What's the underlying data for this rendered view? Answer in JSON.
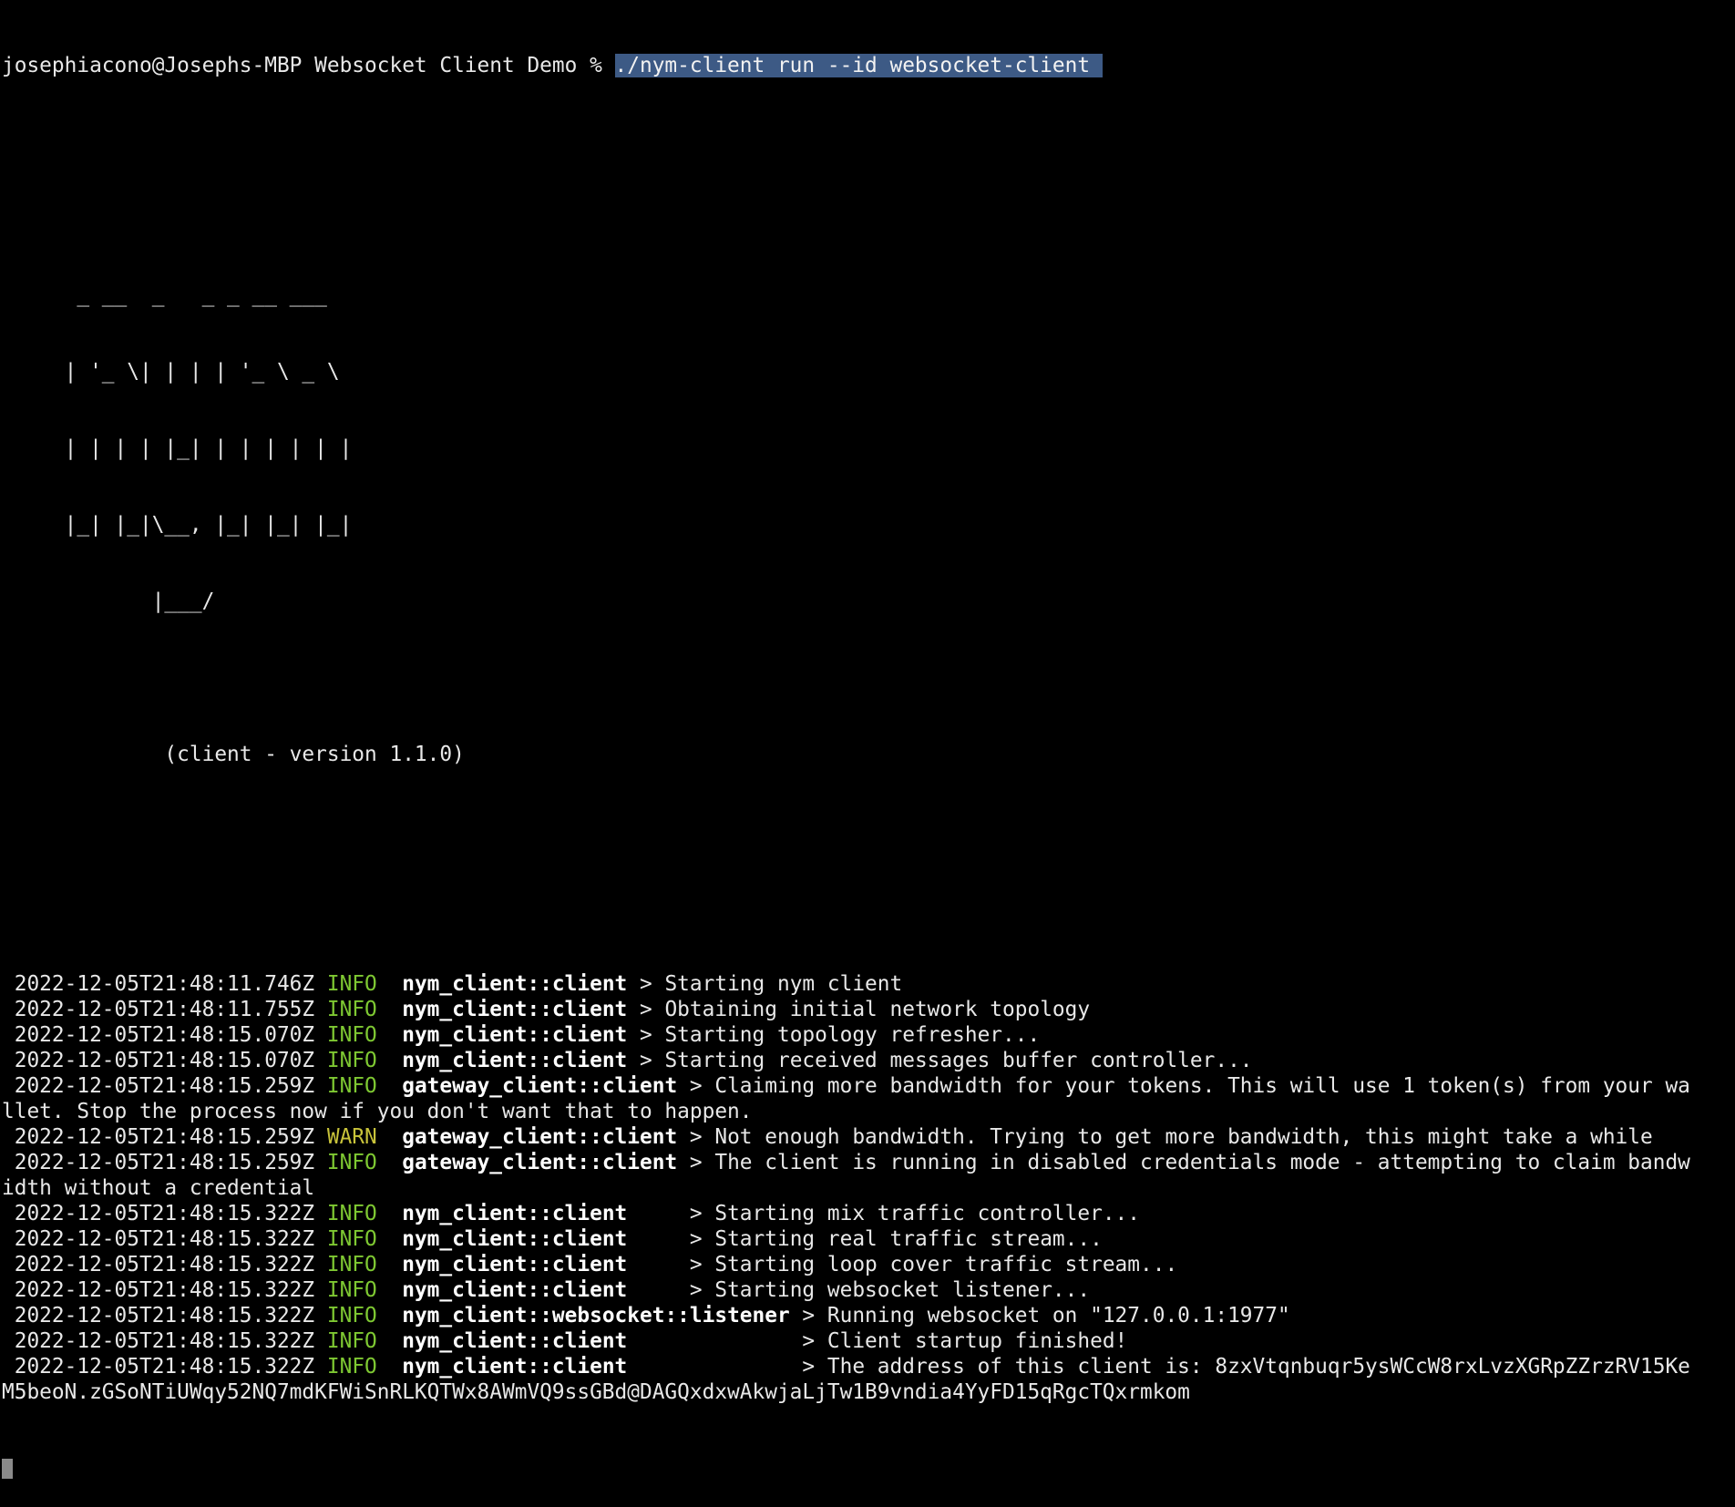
{
  "terminal": {
    "prompt": "josephiacono@Josephs-MBP Websocket Client Demo % ",
    "command": "./nym-client run --id websocket-client "
  },
  "banner": {
    "ascii": [
      "      _ __  _   _ _ __ ___",
      "     | '_ \\| | | | '_ \\ _ \\",
      "     | | | | |_| | | | | | |",
      "     |_| |_|\\__, |_| |_| |_|",
      "            |___/"
    ],
    "version": "             (client - version 1.1.0)"
  },
  "logs": [
    {
      "ts": " 2022-12-05T21:48:11.746Z",
      "level": "INFO",
      "target": "nym_client::client",
      "msg": " > Starting nym client"
    },
    {
      "ts": " 2022-12-05T21:48:11.755Z",
      "level": "INFO",
      "target": "nym_client::client",
      "msg": " > Obtaining initial network topology"
    },
    {
      "ts": " 2022-12-05T21:48:15.070Z",
      "level": "INFO",
      "target": "nym_client::client",
      "msg": " > Starting topology refresher..."
    },
    {
      "ts": " 2022-12-05T21:48:15.070Z",
      "level": "INFO",
      "target": "nym_client::client",
      "msg": " > Starting received messages buffer controller..."
    },
    {
      "ts": " 2022-12-05T21:48:15.259Z",
      "level": "INFO",
      "target": "gateway_client::client",
      "msg": " > Claiming more bandwidth for your tokens. This will use 1 token(s) from your wa",
      "cont": "llet. Stop the process now if you don't want that to happen."
    },
    {
      "ts": " 2022-12-05T21:48:15.259Z",
      "level": "WARN",
      "target": "gateway_client::client",
      "msg": " > Not enough bandwidth. Trying to get more bandwidth, this might take a while"
    },
    {
      "ts": " 2022-12-05T21:48:15.259Z",
      "level": "INFO",
      "target": "gateway_client::client",
      "msg": " > The client is running in disabled credentials mode - attempting to claim bandw",
      "cont": "idth without a credential"
    },
    {
      "ts": " 2022-12-05T21:48:15.322Z",
      "level": "INFO",
      "target": "nym_client::client",
      "msg": "     > Starting mix traffic controller..."
    },
    {
      "ts": " 2022-12-05T21:48:15.322Z",
      "level": "INFO",
      "target": "nym_client::client",
      "msg": "     > Starting real traffic stream..."
    },
    {
      "ts": " 2022-12-05T21:48:15.322Z",
      "level": "INFO",
      "target": "nym_client::client",
      "msg": "     > Starting loop cover traffic stream..."
    },
    {
      "ts": " 2022-12-05T21:48:15.322Z",
      "level": "INFO",
      "target": "nym_client::client",
      "msg": "     > Starting websocket listener..."
    },
    {
      "ts": " 2022-12-05T21:48:15.322Z",
      "level": "INFO",
      "target": "nym_client::websocket::listener",
      "msg": " > Running websocket on \"127.0.0.1:1977\""
    },
    {
      "ts": " 2022-12-05T21:48:15.322Z",
      "level": "INFO",
      "target": "nym_client::client",
      "msg": "              > Client startup finished!"
    },
    {
      "ts": " 2022-12-05T21:48:15.322Z",
      "level": "INFO",
      "target": "nym_client::client",
      "msg": "              > The address of this client is: 8zxVtqnbuqr5ysWCcW8rxLvzXGRpZZrzRV15Ke",
      "cont": "M5beoN.zGSoNTiUWqy52NQ7mdKFWiSnRLKQTWx8AWmVQ9ssGBd@DAGQxdxwAkwjaLjTw1B9vndia4YyFD15qRgcTQxrmkom"
    }
  ],
  "colors": {
    "background": "#000000",
    "info": "#7ec832",
    "warn": "#c8c33a",
    "selection": "#3d5a85"
  }
}
